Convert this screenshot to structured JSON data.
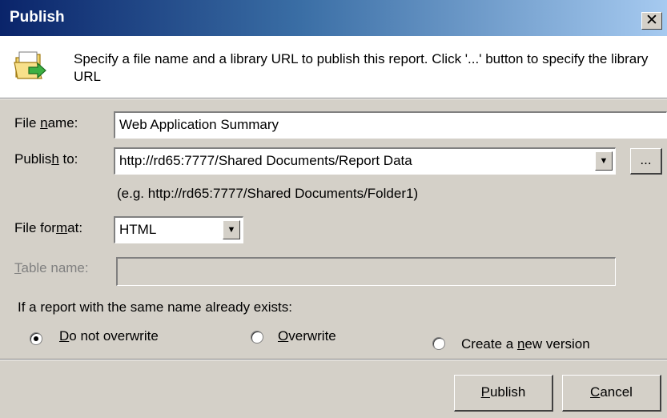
{
  "window": {
    "title": "Publish",
    "close_glyph": "✕"
  },
  "header": {
    "icon": "publish-folder-arrow-icon",
    "text": "Specify a file name and a library URL to publish this report. Click '...' button to specify the library URL"
  },
  "file_name": {
    "label_pre": "File ",
    "label_key": "n",
    "label_post": "ame:",
    "value": "Web Application Summary"
  },
  "publish_to": {
    "label_pre": "Publis",
    "label_key": "h",
    "label_post": " to:",
    "value": "http://rd65:7777/Shared Documents/Report Data",
    "browse_label": "...",
    "example": "(e.g. http://rd65:7777/Shared Documents/Folder1)"
  },
  "file_format": {
    "label_pre": "File for",
    "label_key": "m",
    "label_post": "at:",
    "value": "HTML"
  },
  "table_name": {
    "label_key": "T",
    "label_post": "able name:",
    "value": ""
  },
  "overwrite": {
    "question": "If a report with the same name already exists:",
    "options": [
      {
        "pre": "",
        "key": "D",
        "post": "o not overwrite",
        "selected": true
      },
      {
        "pre": "",
        "key": "O",
        "post": "verwrite",
        "selected": false
      },
      {
        "pre": "Create a ",
        "key": "n",
        "post": "ew version",
        "selected": false
      }
    ]
  },
  "buttons": {
    "publish": {
      "key": "P",
      "post": "ublish"
    },
    "cancel": {
      "key": "C",
      "post": "ancel"
    }
  },
  "colors": {
    "titlebar_start": "#0a246a",
    "titlebar_end": "#a6caf0",
    "dialog_bg": "#d4d0c8"
  }
}
